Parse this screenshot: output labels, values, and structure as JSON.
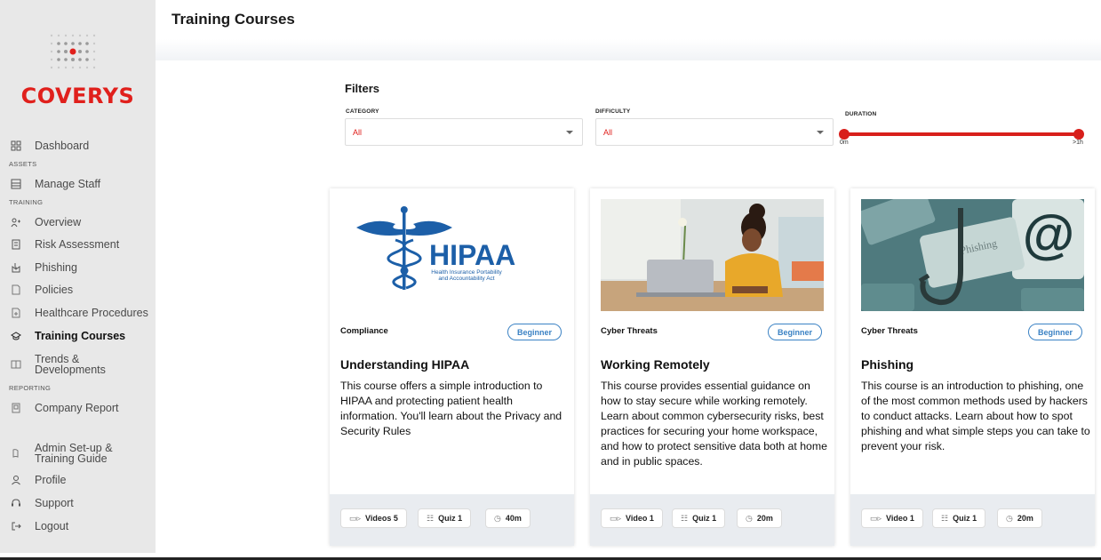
{
  "brand": {
    "name": "COVERYS",
    "accent": "#e0201c"
  },
  "sidebar": {
    "items": [
      {
        "label": "Dashboard",
        "icon": "dashboard-icon"
      },
      {
        "label": "Manage Staff",
        "icon": "staff-icon"
      },
      {
        "label": "Overview",
        "icon": "overview-icon"
      },
      {
        "label": "Risk Assessment",
        "icon": "risk-icon"
      },
      {
        "label": "Phishing",
        "icon": "phishing-icon"
      },
      {
        "label": "Policies",
        "icon": "policies-icon"
      },
      {
        "label": "Healthcare Procedures",
        "icon": "procedures-icon"
      },
      {
        "label": "Training Courses",
        "icon": "graduation-cap-icon",
        "active": true
      },
      {
        "label": "Trends & Developments",
        "icon": "trends-icon"
      },
      {
        "label": "Company Report",
        "icon": "report-icon"
      },
      {
        "label": "Admin Set-up & Training Guide",
        "icon": "guide-icon"
      },
      {
        "label": "Profile",
        "icon": "user-icon"
      },
      {
        "label": "Support",
        "icon": "headset-icon"
      },
      {
        "label": "Logout",
        "icon": "logout-icon"
      }
    ],
    "sections": {
      "assets": "ASSETS",
      "training": "TRAINING",
      "reporting": "REPORTING"
    },
    "trends_line1": "Trends &",
    "trends_line2": "Developments",
    "admin_line1": "Admin Set-up &",
    "admin_line2": "Training Guide"
  },
  "header": {
    "title": "Training Courses"
  },
  "filters": {
    "title": "Filters",
    "category": {
      "label": "CATEGORY",
      "value": "All"
    },
    "difficulty": {
      "label": "DIFFICULTY",
      "value": "All"
    },
    "duration": {
      "label": "DURATION",
      "min": "0m",
      "max": ">1h",
      "range_fraction": [
        0,
        1
      ]
    }
  },
  "courses": [
    {
      "category": "Compliance",
      "level": "Beginner",
      "title": "Understanding HIPAA",
      "description": "This course offers a simple introduction to HIPAA and protecting patient health information. You'll learn about the Privacy and Security Rules",
      "image_text": "HIPAA",
      "image_subtext_1": "Health Insurance Portability",
      "image_subtext_2": "and Accountability Act",
      "videos": "Videos 5",
      "quiz": "Quiz 1",
      "duration": "40m"
    },
    {
      "category": "Cyber Threats",
      "level": "Beginner",
      "title": "Working Remotely",
      "description": "This course provides essential guidance on how to stay secure while working remotely. Learn about common cybersecurity risks, best practices for securing your home workspace, and how to protect sensitive data both at home and in public spaces.",
      "videos": "Video 1",
      "quiz": "Quiz 1",
      "duration": "20m"
    },
    {
      "category": "Cyber Threats",
      "level": "Beginner",
      "title": "Phishing",
      "description": "This course is an introduction to phishing, one of the most common methods used by hackers to conduct attacks. Learn about how to spot phishing and what simple steps you can take to prevent your risk.",
      "image_text": "Phishing",
      "videos": "Video 1",
      "quiz": "Quiz 1",
      "duration": "20m"
    }
  ]
}
